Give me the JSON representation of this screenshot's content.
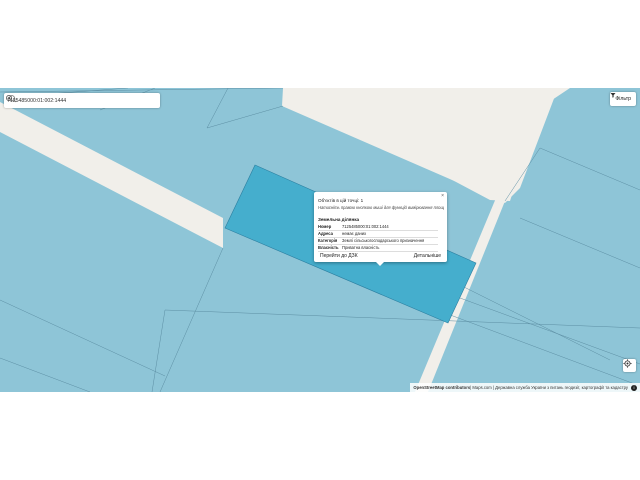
{
  "search": {
    "value": "7125485000:01:002:1444"
  },
  "filter": {
    "label": "Фільтр",
    "icon": "filter-icon"
  },
  "popup": {
    "count_text": "Об'єктів в цій точці: 1",
    "hint": "Натисніть правою кнопкою миші для функцій вимірювання площ",
    "section": "Земельна ділянка",
    "rows": [
      {
        "key": "Номер",
        "value": "7125485000:01:002:1444"
      },
      {
        "key": "Адреса",
        "value": "немає даних"
      },
      {
        "key": "Категорія",
        "value": "Землі сільськогосподарського призначення"
      },
      {
        "key": "Власність",
        "value": "Приватна власність"
      }
    ],
    "goto_label": "Перейти до ДЗК",
    "details_label": "Детальніше",
    "close": "×"
  },
  "attribution": {
    "source": "OpenStreetMap contributors",
    "rest": " | Maps.com | Державна служба України з питань геодезії, картографії та кадастру"
  },
  "colors": {
    "parcel": "#8ec5d7",
    "selected": "#45aecd",
    "road": "#f1efea",
    "border": "#5c8ea3"
  }
}
